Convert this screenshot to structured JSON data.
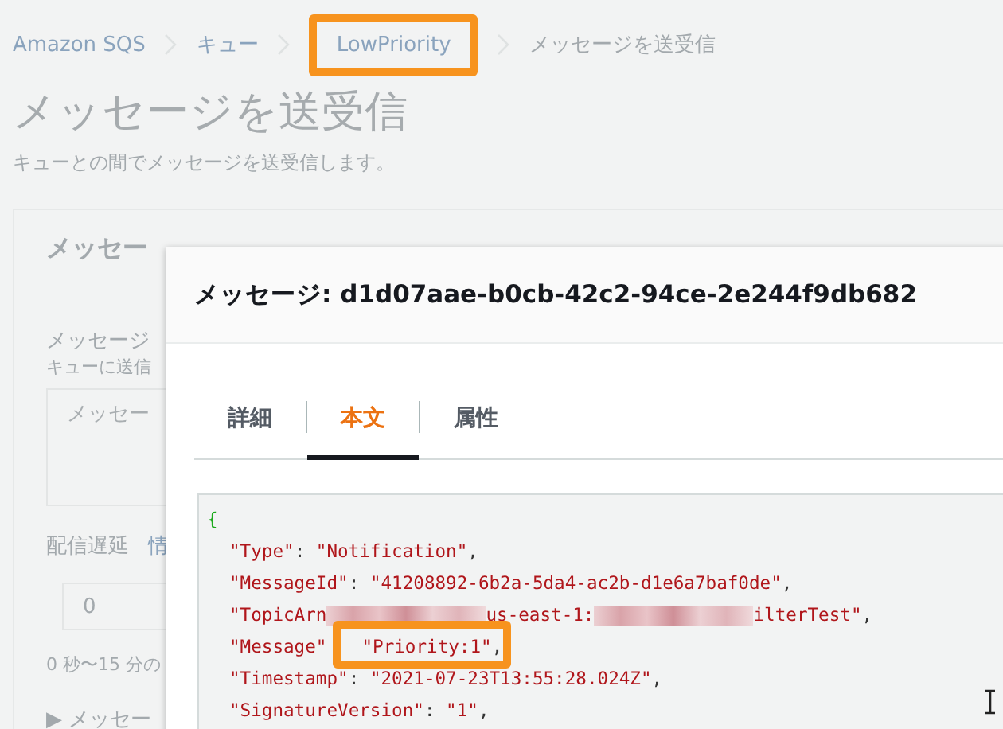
{
  "breadcrumbs": [
    {
      "label": "Amazon SQS",
      "link": true,
      "highlighted": false
    },
    {
      "label": "キュー",
      "link": true,
      "highlighted": false
    },
    {
      "label": "LowPriority",
      "link": true,
      "highlighted": true
    },
    {
      "label": "メッセージを送受信",
      "link": false,
      "highlighted": false
    }
  ],
  "page": {
    "title": "メッセージを送受信",
    "subtitle": "キューとの間でメッセージを送受信します。"
  },
  "send_panel": {
    "heading": "メッセー",
    "body_label": "メッセージ",
    "body_hint": "キューに送信",
    "body_placeholder": "メッセー",
    "delay_label": "配信遅延",
    "delay_link": "情",
    "delay_value": "0",
    "delay_hint": "0 秒〜15 分の",
    "attributes_toggle": "▶ メッセー"
  },
  "modal": {
    "title": "メッセージ: d1d07aae-b0cb-42c2-94ce-2e244f9db682",
    "tabs": [
      {
        "label": "詳細",
        "selected": false
      },
      {
        "label": "本文",
        "selected": true
      },
      {
        "label": "属性",
        "selected": false
      }
    ],
    "code_lines": [
      [
        {
          "kind": "brace",
          "text": "{"
        }
      ],
      [
        {
          "kind": "key",
          "text": "\"Type\""
        },
        {
          "kind": "punct",
          "text": ": "
        },
        {
          "kind": "value",
          "text": "\"Notification\""
        },
        {
          "kind": "punct",
          "text": ","
        }
      ],
      [
        {
          "kind": "key",
          "text": "\"MessageId\""
        },
        {
          "kind": "punct",
          "text": ": "
        },
        {
          "kind": "value",
          "text": "\"41208892-6b2a-5da4-ac2b-d1e6a7baf0de\""
        },
        {
          "kind": "punct",
          "text": ","
        }
      ],
      [
        {
          "kind": "key",
          "text": "\"TopicArn"
        },
        {
          "kind": "redacted"
        },
        {
          "kind": "value",
          "text": "us-east-1:"
        },
        {
          "kind": "redacted"
        },
        {
          "kind": "value",
          "text": "ilterTest\""
        },
        {
          "kind": "punct",
          "text": ","
        }
      ],
      [
        {
          "kind": "key",
          "text": "\"Message\""
        },
        {
          "kind": "value",
          "text": "\"Priority:1\"",
          "highlighted": true
        },
        {
          "kind": "punct",
          "text": ","
        }
      ],
      [
        {
          "kind": "key",
          "text": "\"Timestamp\""
        },
        {
          "kind": "punct",
          "text": ": "
        },
        {
          "kind": "value",
          "text": "\"2021-07-23T13:55:28.024Z\""
        },
        {
          "kind": "punct",
          "text": ","
        }
      ],
      [
        {
          "kind": "key",
          "text": "\"SignatureVersion\""
        },
        {
          "kind": "punct",
          "text": ": "
        },
        {
          "kind": "value",
          "text": "\"1\""
        },
        {
          "kind": "punct",
          "text": ","
        }
      ]
    ]
  }
}
